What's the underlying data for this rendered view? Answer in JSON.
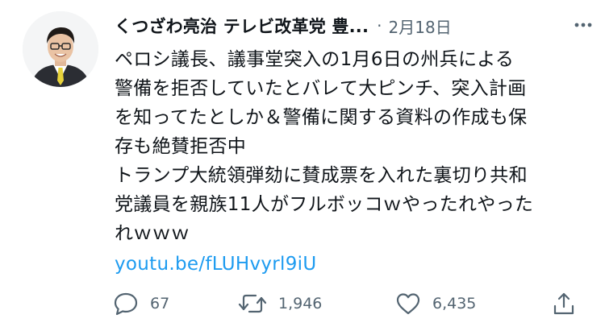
{
  "tweet": {
    "author_name": "くつざわ亮治 テレビ改革党 豊...",
    "separator": "·",
    "date": "2月18日",
    "text_paragraph_1": "ペロシ議長、議事堂突入の1月6日の州兵による\n警備を拒否していたとバレて大ピンチ、突入計画\nを知ってたとしか＆警備に関する資料の作成も保\n存も絶賛拒否中",
    "text_paragraph_2": "トランプ大統領弾劾に賛成票を入れた裏切り共和\n党議員を親族11人がフルボッコｗやったれやった\nれｗｗｗ",
    "link": "youtu.be/fLUHvyrl9iU"
  },
  "actions": {
    "reply_count": "67",
    "retweet_count": "1,946",
    "like_count": "6,435"
  },
  "colors": {
    "text": "#0f1419",
    "muted": "#536471",
    "link": "#1d9bf0"
  },
  "icons": [
    "more-icon",
    "reply-icon",
    "retweet-icon",
    "like-icon",
    "share-icon"
  ]
}
